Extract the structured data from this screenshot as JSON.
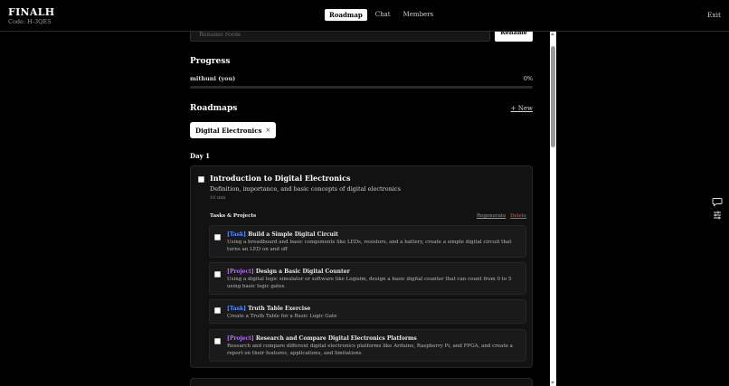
{
  "header": {
    "title": "FINALH",
    "code": "Code: H-3QES",
    "tabs": [
      {
        "label": "Roadmap",
        "active": true
      },
      {
        "label": "Chat",
        "active": false
      },
      {
        "label": "Members",
        "active": false
      }
    ],
    "exit_label": "Exit"
  },
  "rename": {
    "placeholder": "Rename room",
    "button_label": "Rename"
  },
  "progress": {
    "title": "Progress",
    "user": "mithuni (you)",
    "percent_label": "0%",
    "percent": 0
  },
  "roadmaps": {
    "title": "Roadmaps",
    "new_label": "+ New",
    "chips": [
      {
        "label": "Digital Electronics",
        "close": "×"
      }
    ]
  },
  "day": {
    "label": "Day 1",
    "lesson": {
      "title": "Introduction to Digital Electronics",
      "description": "Definition, importance, and basic concepts of digital electronics",
      "duration": "10 min",
      "tasks_heading": "Tasks & Projects",
      "regenerate_label": "Regenerate",
      "delete_label": "Delete",
      "tasks": [
        {
          "tag": "[Task]",
          "title": "Build a Simple Digital Circuit",
          "description": "Using a breadboard and basic components like LEDs, resistors, and a battery, create a simple digital circuit that turns an LED on and off"
        },
        {
          "tag": "[Project]",
          "title": "Design a Basic Digital Counter",
          "description": "Using a digital logic simulator or software like Logisim, design a basic digital counter that can count from 0 to 5 using basic logic gates"
        },
        {
          "tag": "[Task]",
          "title": "Truth Table Exercise",
          "description": "Create a Truth Table for a Basic Logic Gate"
        },
        {
          "tag": "[Project]",
          "title": "Research and Compare Digital Electronics Platforms",
          "description": "Research and compare different digital electronics platforms like Arduino, Raspberry Pi, and FPGA, and create a report on their features, applications, and limitations"
        }
      ]
    }
  },
  "colors": {
    "background": "#000000",
    "task_tag": "#5b8cff",
    "project_tag": "#b56bff",
    "delete": "#e05555"
  },
  "icons": [
    "chat-bubble-icon",
    "sliders-icon"
  ]
}
